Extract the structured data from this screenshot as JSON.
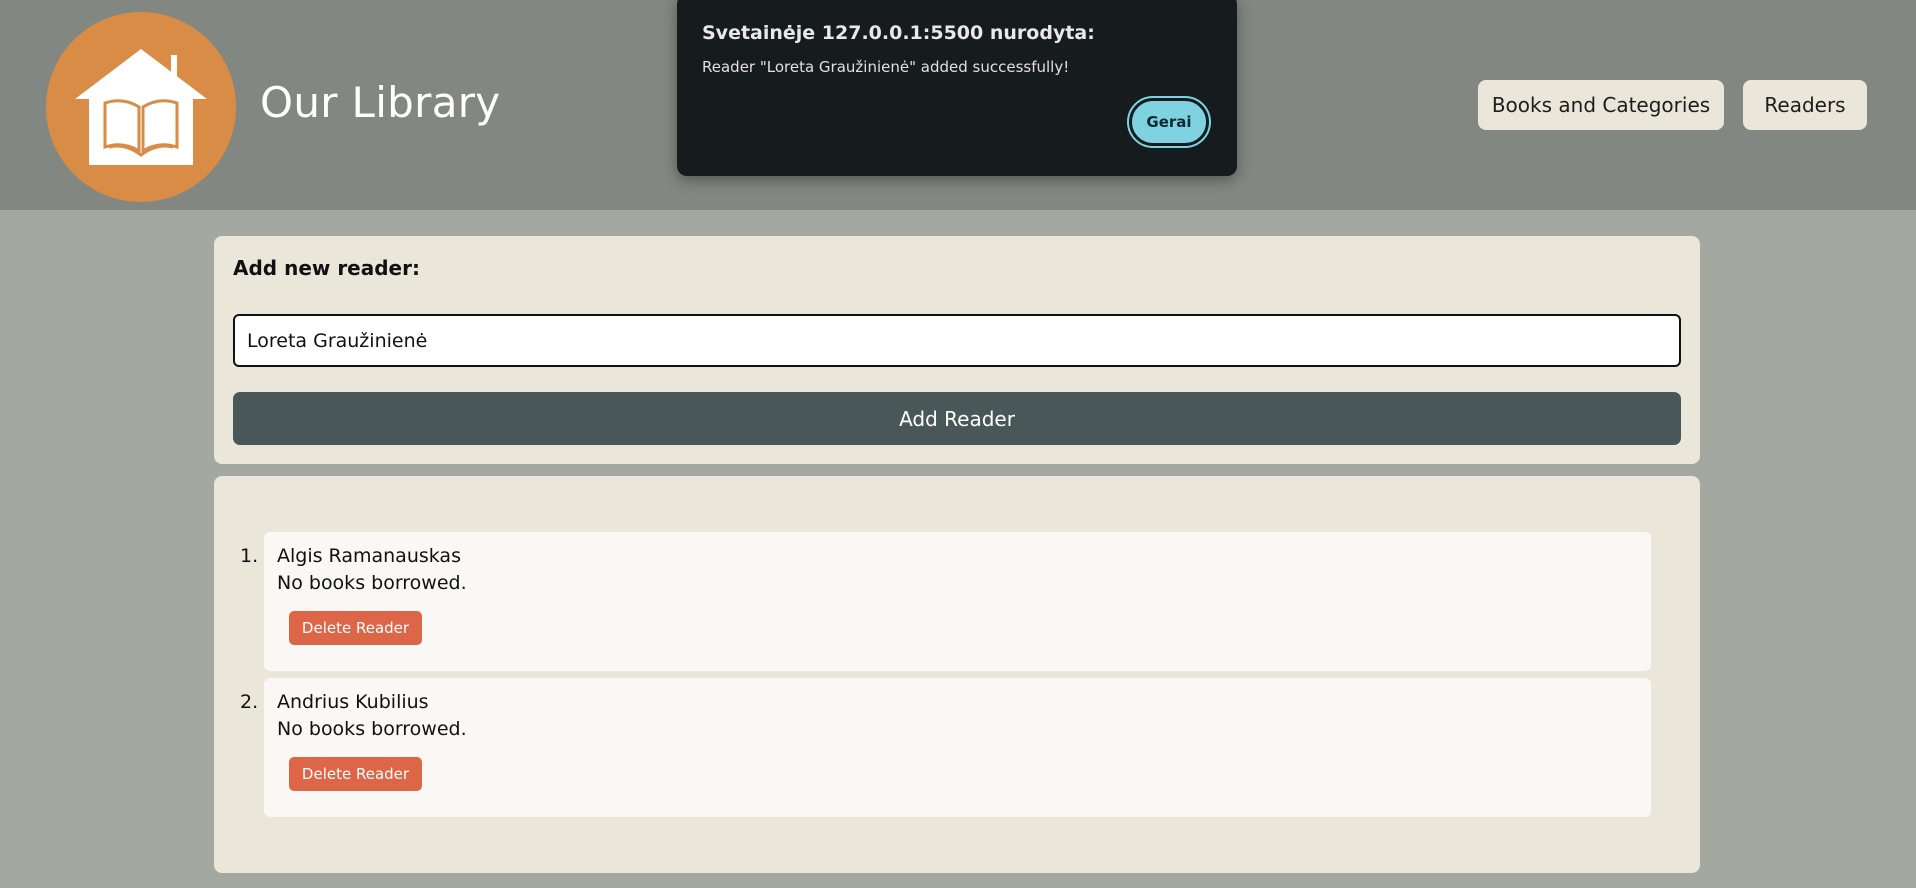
{
  "header": {
    "title": "Our Library",
    "logo_icon": "house-book-icon",
    "nav": [
      {
        "label": "Books and Categories"
      },
      {
        "label": "Readers"
      }
    ]
  },
  "form": {
    "label": "Add new reader:",
    "input_value": "Loreta Graužinienė",
    "submit_label": "Add Reader"
  },
  "readers": [
    {
      "number": "1.",
      "name": "Algis Ramanauskas",
      "status": "No books borrowed.",
      "delete_label": "Delete Reader"
    },
    {
      "number": "2.",
      "name": "Andrius Kubilius",
      "status": "No books borrowed.",
      "delete_label": "Delete Reader"
    }
  ],
  "dialog": {
    "title": "Svetainėje 127.0.0.1:5500 nurodyta:",
    "message": "Reader \"Loreta Graužinienė\" added successfully!",
    "ok_label": "Gerai"
  },
  "colors": {
    "header_bg": "#828781",
    "page_bg": "#a3a9a1",
    "card_bg": "#ebe6da",
    "logo_bg": "#d98c46",
    "primary_button": "#4a5758",
    "danger_button": "#dd6648",
    "dialog_bg": "#161b1e",
    "dialog_button": "#7fd3e0"
  }
}
